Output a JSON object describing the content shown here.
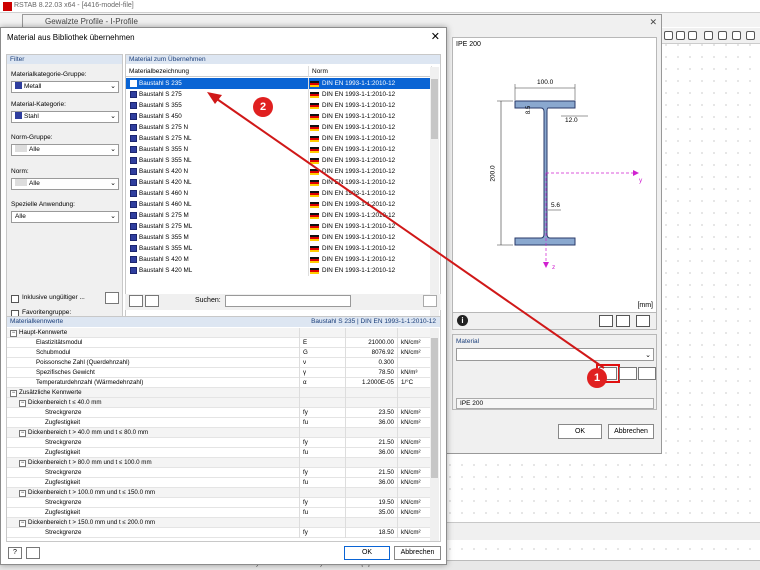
{
  "app": {
    "title": "RSTAB 8.22.03 x64 - [4416-model-file]"
  },
  "profile_window": {
    "title": "Gewalzte Profile - I-Profile",
    "preview_title": "IPE 200",
    "unit": "[mm]",
    "dims": {
      "width": "100.0",
      "flange": "8.5",
      "r": "12.0",
      "height": "200.0",
      "web": "5.6"
    },
    "axes": {
      "y": "y",
      "z": "z"
    },
    "material_header": "Material",
    "profile_name": "IPE 200",
    "ok": "OK",
    "cancel": "Abbrechen"
  },
  "dialog": {
    "title": "Material aus Bibliothek übernehmen",
    "filter": {
      "header": "Filter",
      "group_label": "Materialkategorie-Gruppe:",
      "group_value": "Metall",
      "category_label": "Material-Kategorie:",
      "category_value": "Stahl",
      "norm_group_label": "Norm-Gruppe:",
      "norm_group_value": "Alle",
      "norm_label": "Norm:",
      "norm_value": "Alle",
      "application_label": "Spezielle Anwendung:",
      "application_value": "Alle",
      "invalid_label": "Inklusive ungültiger ...",
      "favorite_label": "Favoritengruppe:"
    },
    "list": {
      "header": "Material zum Übernehmen",
      "col_name": "Materialbezeichnung",
      "col_norm": "Norm",
      "search_label": "Suchen:",
      "rows": [
        {
          "name": "Baustahl S 235",
          "norm": "DIN EN 1993-1-1:2010-12",
          "selected": true
        },
        {
          "name": "Baustahl S 275",
          "norm": "DIN EN 1993-1-1:2010-12"
        },
        {
          "name": "Baustahl S 355",
          "norm": "DIN EN 1993-1-1:2010-12"
        },
        {
          "name": "Baustahl S 450",
          "norm": "DIN EN 1993-1-1:2010-12"
        },
        {
          "name": "Baustahl S 275 N",
          "norm": "DIN EN 1993-1-1:2010-12"
        },
        {
          "name": "Baustahl S 275 NL",
          "norm": "DIN EN 1993-1-1:2010-12"
        },
        {
          "name": "Baustahl S 355 N",
          "norm": "DIN EN 1993-1-1:2010-12"
        },
        {
          "name": "Baustahl S 355 NL",
          "norm": "DIN EN 1993-1-1:2010-12"
        },
        {
          "name": "Baustahl S 420 N",
          "norm": "DIN EN 1993-1-1:2010-12"
        },
        {
          "name": "Baustahl S 420 NL",
          "norm": "DIN EN 1993-1-1:2010-12"
        },
        {
          "name": "Baustahl S 460 N",
          "norm": "DIN EN 1993-1-1:2010-12"
        },
        {
          "name": "Baustahl S 460 NL",
          "norm": "DIN EN 1993-1-1:2010-12"
        },
        {
          "name": "Baustahl S 275 M",
          "norm": "DIN EN 1993-1-1:2010-12"
        },
        {
          "name": "Baustahl S 275 ML",
          "norm": "DIN EN 1993-1-1:2010-12"
        },
        {
          "name": "Baustahl S 355 M",
          "norm": "DIN EN 1993-1-1:2010-12"
        },
        {
          "name": "Baustahl S 355 ML",
          "norm": "DIN EN 1993-1-1:2010-12"
        },
        {
          "name": "Baustahl S 420 M",
          "norm": "DIN EN 1993-1-1:2010-12"
        },
        {
          "name": "Baustahl S 420 ML",
          "norm": "DIN EN 1993-1-1:2010-12"
        }
      ]
    },
    "props": {
      "header": "Materialkennwerte",
      "header_right": "Baustahl S 235 | DIN EN 1993-1-1:2010-12",
      "rows": [
        {
          "level": 0,
          "group": true,
          "name": "Haupt-Kennwerte",
          "sym": "",
          "val": "",
          "unit": ""
        },
        {
          "level": 2,
          "name": "Elastizitätsmodul",
          "sym": "E",
          "val": "21000.00",
          "unit": "kN/cm²"
        },
        {
          "level": 2,
          "name": "Schubmodul",
          "sym": "G",
          "val": "8076.92",
          "unit": "kN/cm²"
        },
        {
          "level": 2,
          "name": "Poissonsche Zahl (Querdehnzahl)",
          "sym": "ν",
          "val": "0.300",
          "unit": ""
        },
        {
          "level": 2,
          "name": "Spezifisches Gewicht",
          "sym": "γ",
          "val": "78.50",
          "unit": "kN/m³"
        },
        {
          "level": 2,
          "name": "Temperaturdehnzahl (Wärmedehnzahl)",
          "sym": "α",
          "val": "1.2000E-05",
          "unit": "1/°C"
        },
        {
          "level": 0,
          "group": true,
          "name": "Zusätzliche Kennwerte",
          "sym": "",
          "val": "",
          "unit": ""
        },
        {
          "level": 1,
          "group": true,
          "name": "Dickenbereich t ≤ 40.0 mm",
          "sym": "",
          "val": "",
          "unit": ""
        },
        {
          "level": 3,
          "name": "Streckgrenze",
          "sym": "fy",
          "val": "23.50",
          "unit": "kN/cm²"
        },
        {
          "level": 3,
          "name": "Zugfestigkeit",
          "sym": "fu",
          "val": "36.00",
          "unit": "kN/cm²"
        },
        {
          "level": 1,
          "group": true,
          "name": "Dickenbereich t > 40.0 mm und t ≤ 80.0 mm",
          "sym": "",
          "val": "",
          "unit": ""
        },
        {
          "level": 3,
          "name": "Streckgrenze",
          "sym": "fy",
          "val": "21.50",
          "unit": "kN/cm²"
        },
        {
          "level": 3,
          "name": "Zugfestigkeit",
          "sym": "fu",
          "val": "36.00",
          "unit": "kN/cm²"
        },
        {
          "level": 1,
          "group": true,
          "name": "Dickenbereich t > 80.0 mm und t ≤ 100.0 mm",
          "sym": "",
          "val": "",
          "unit": ""
        },
        {
          "level": 3,
          "name": "Streckgrenze",
          "sym": "fy",
          "val": "21.50",
          "unit": "kN/cm²"
        },
        {
          "level": 3,
          "name": "Zugfestigkeit",
          "sym": "fu",
          "val": "36.00",
          "unit": "kN/cm²"
        },
        {
          "level": 1,
          "group": true,
          "name": "Dickenbereich t > 100.0 mm und t ≤ 150.0 mm",
          "sym": "",
          "val": "",
          "unit": ""
        },
        {
          "level": 3,
          "name": "Streckgrenze",
          "sym": "fy",
          "val": "19.50",
          "unit": "kN/cm²"
        },
        {
          "level": 3,
          "name": "Zugfestigkeit",
          "sym": "fu",
          "val": "35.00",
          "unit": "kN/cm²"
        },
        {
          "level": 1,
          "group": true,
          "name": "Dickenbereich t > 150.0 mm und t ≤ 200.0 mm",
          "sym": "",
          "val": "",
          "unit": ""
        },
        {
          "level": 3,
          "name": "Streckgrenze",
          "sym": "fy",
          "val": "18.50",
          "unit": "kN/cm²"
        }
      ]
    },
    "ok": "OK",
    "cancel": "Abbrechen",
    "help": "?"
  },
  "annotations": {
    "badge1": "1",
    "badge2": "2"
  },
  "statusbar": [
    "Knoten",
    "System",
    "Analyse",
    "Z [m]"
  ],
  "colors": {
    "selection": "#0a64d4",
    "annotation": "#e02020",
    "swatch": "#2f3e9e"
  }
}
